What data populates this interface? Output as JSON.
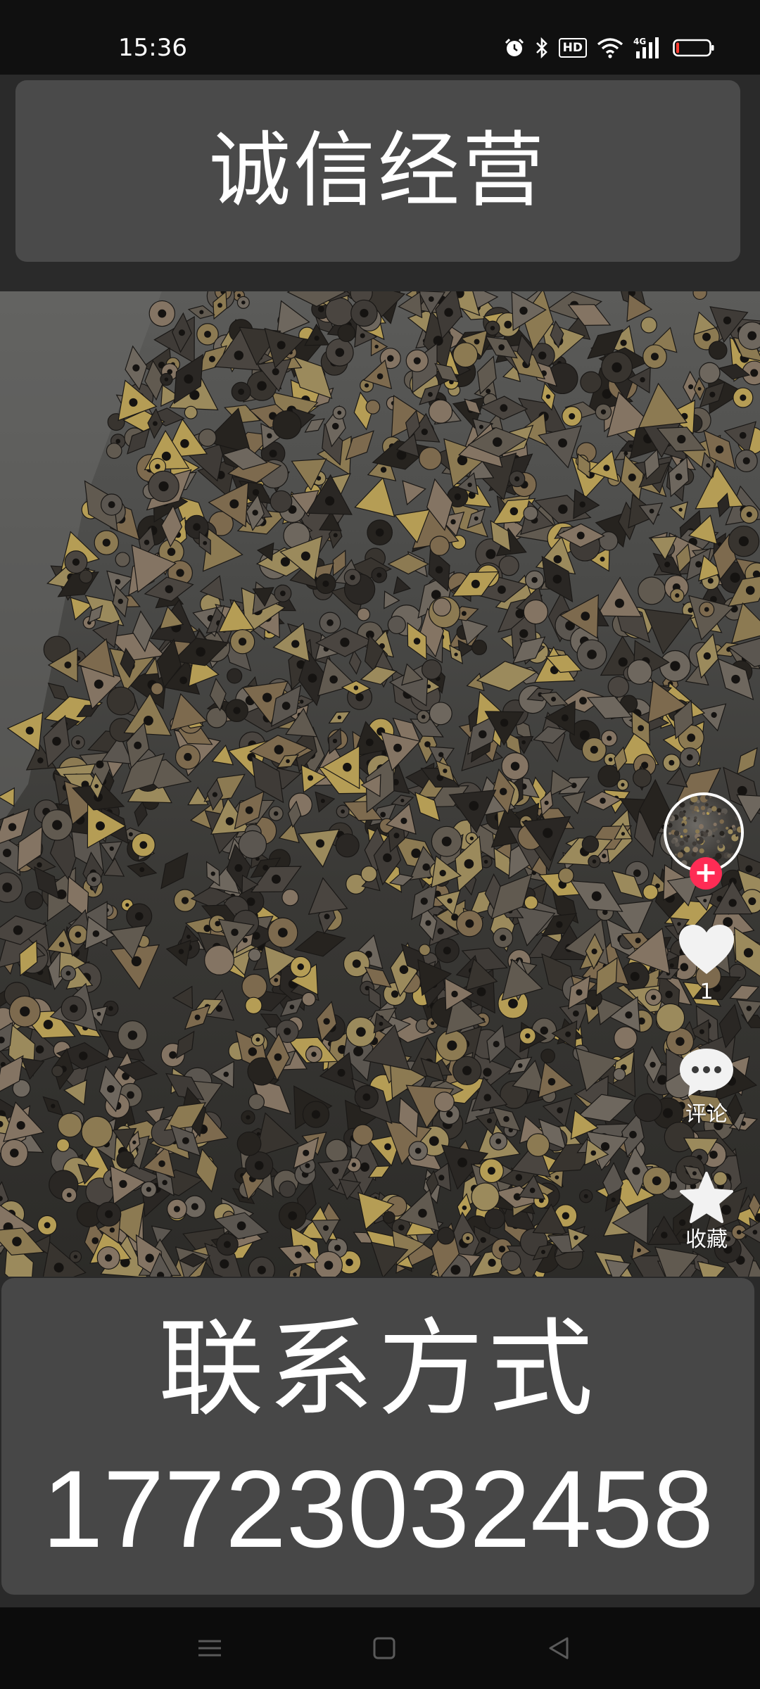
{
  "status_bar": {
    "time": "15:36",
    "hd_label": "HD",
    "network_label": "4G",
    "battery_level": 0.08
  },
  "top_banner": {
    "text": "诚信经营"
  },
  "bottom_banner": {
    "contact_label": "联系方式",
    "phone": "17723032458"
  },
  "actions": {
    "follow_symbol": "+",
    "like_count": "1",
    "comment_label": "评论",
    "favorite_label": "收藏"
  },
  "icons": {
    "alarm": "alarm-icon",
    "bluetooth": "bluetooth-icon",
    "wifi": "wifi-icon",
    "signal": "signal-icon",
    "battery": "battery-icon",
    "heart": "heart-icon",
    "comment": "comment-bubble-icon",
    "star": "star-icon",
    "menu": "menu-icon",
    "home": "home-square-icon",
    "back": "back-triangle-icon"
  },
  "colors": {
    "follow_accent": "#fe2c55",
    "battery_low": "#ff3b30",
    "banner_bg": "#4a4a4a"
  }
}
